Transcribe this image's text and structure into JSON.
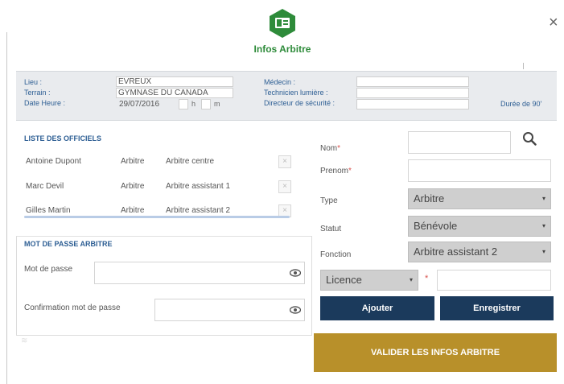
{
  "header": {
    "title": "Infos Arbitre",
    "close_label": "×",
    "icon": "id-card-hexagon-icon",
    "accent_color": "#2e8b3a"
  },
  "info": {
    "lieu_label": "Lieu :",
    "lieu_value": "EVREUX",
    "terrain_label": "Terrain :",
    "terrain_value": "GYMNASE DU CANADA",
    "date_label": "Date Heure :",
    "date_value": "29/07/2016",
    "hour_unit": "h",
    "minute_unit": "m",
    "medecin_label": "Médecin :",
    "technicien_label": "Technicien lumière :",
    "directeur_label": "Directeur de sécurité :",
    "duree_label": "Durée de 90'"
  },
  "officials": {
    "title": "LISTE DES OFFICIELS",
    "rows": [
      {
        "name": "Antoine Dupont",
        "type": "Arbitre",
        "fonction": "Arbitre centre"
      },
      {
        "name": "Marc Devil",
        "type": "Arbitre",
        "fonction": "Arbitre assistant 1"
      },
      {
        "name": "Gilles Martin",
        "type": "Arbitre",
        "fonction": "Arbitre assistant 2"
      }
    ],
    "delete_label": "×"
  },
  "password": {
    "title": "MOT DE PASSE ARBITRE",
    "password_label": "Mot de passe",
    "confirm_label": "Confirmation mot de passe",
    "eye_icon": "eye-icon"
  },
  "form": {
    "nom_label": "Nom",
    "prenom_label": "Prenom",
    "required_mark": "*",
    "type_label": "Type",
    "type_value": "Arbitre",
    "statut_label": "Statut",
    "statut_value": "Bénévole",
    "fonction_label": "Fonction",
    "fonction_value": "Arbitre assistant 2",
    "licence_value": "Licence",
    "select_arrow": "▾",
    "add_label": "Ajouter",
    "save_label": "Enregistrer",
    "validate_label": "VALIDER LES INFOS ARBITRE",
    "search_icon": "search-icon"
  },
  "colors": {
    "dark_button": "#1b3a5c",
    "gold_button": "#b8902a",
    "label_blue": "#2e5f94"
  }
}
